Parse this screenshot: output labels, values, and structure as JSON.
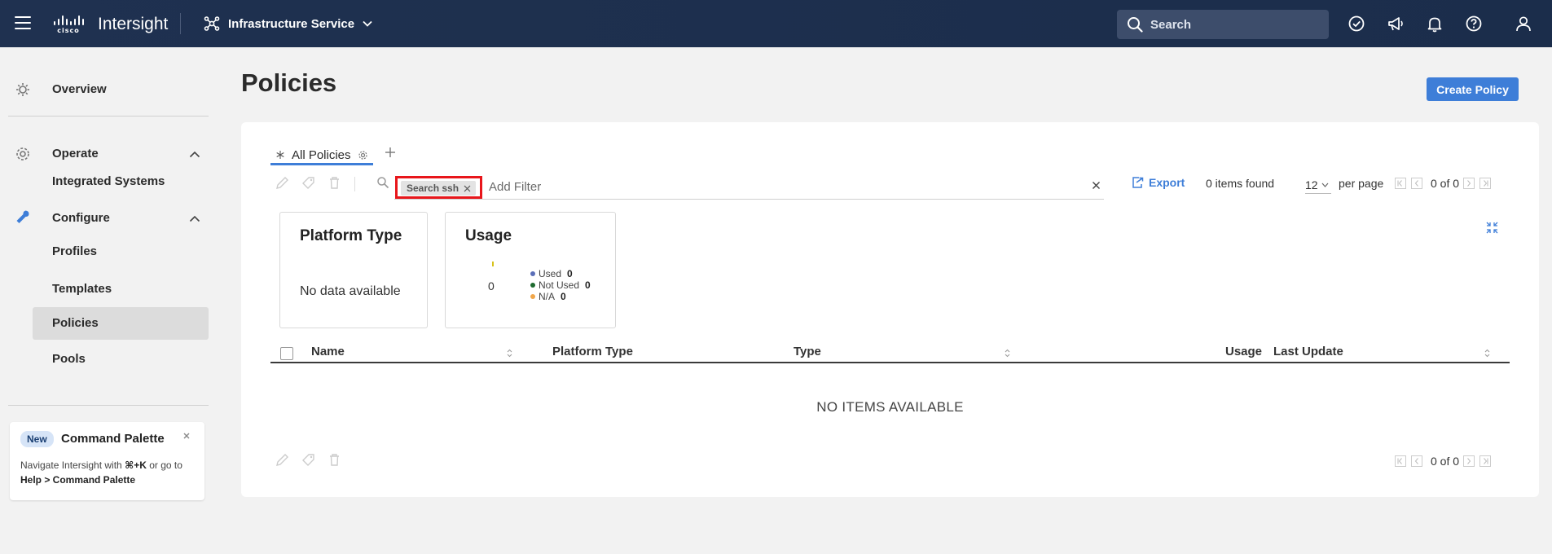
{
  "header": {
    "app_title": "Intersight",
    "service_label": "Infrastructure Service",
    "search_placeholder": "Search"
  },
  "sidebar": {
    "overview": "Overview",
    "operate": "Operate",
    "integrated_systems": "Integrated Systems",
    "configure": "Configure",
    "profiles": "Profiles",
    "templates": "Templates",
    "policies": "Policies",
    "pools": "Pools",
    "command_palette": {
      "badge": "New",
      "title": "Command Palette",
      "desc_prefix": "Navigate Intersight with ",
      "shortcut": "⌘+K",
      "desc_mid": " or go to ",
      "path": "Help > Command Palette"
    }
  },
  "page": {
    "title": "Policies",
    "create_button": "Create Policy"
  },
  "tabs": [
    {
      "label": "All Policies"
    }
  ],
  "filter": {
    "chip_label": "Search ssh",
    "placeholder": "Add Filter"
  },
  "toolbar": {
    "export_label": "Export",
    "items_found": "0 items found",
    "per_page_value": "12",
    "per_page_label": "per page",
    "page_info": "0 of 0"
  },
  "cards": {
    "platform_type": {
      "title": "Platform Type",
      "empty": "No data available"
    },
    "usage": {
      "title": "Usage",
      "center_value": "0",
      "legend": [
        {
          "label": "Used",
          "value": "0",
          "color": "#5b6fb8"
        },
        {
          "label": "Not Used",
          "value": "0",
          "color": "#1e6b2f"
        },
        {
          "label": "N/A",
          "value": "0",
          "color": "#f0a64a"
        }
      ]
    }
  },
  "table": {
    "columns": [
      "Name",
      "Platform Type",
      "Type",
      "Usage",
      "Last Update"
    ],
    "empty_text": "NO ITEMS AVAILABLE"
  },
  "colors": {
    "accent": "#3e7ed8",
    "header_bg": "#1f3150",
    "highlight_red": "#e8161b"
  }
}
